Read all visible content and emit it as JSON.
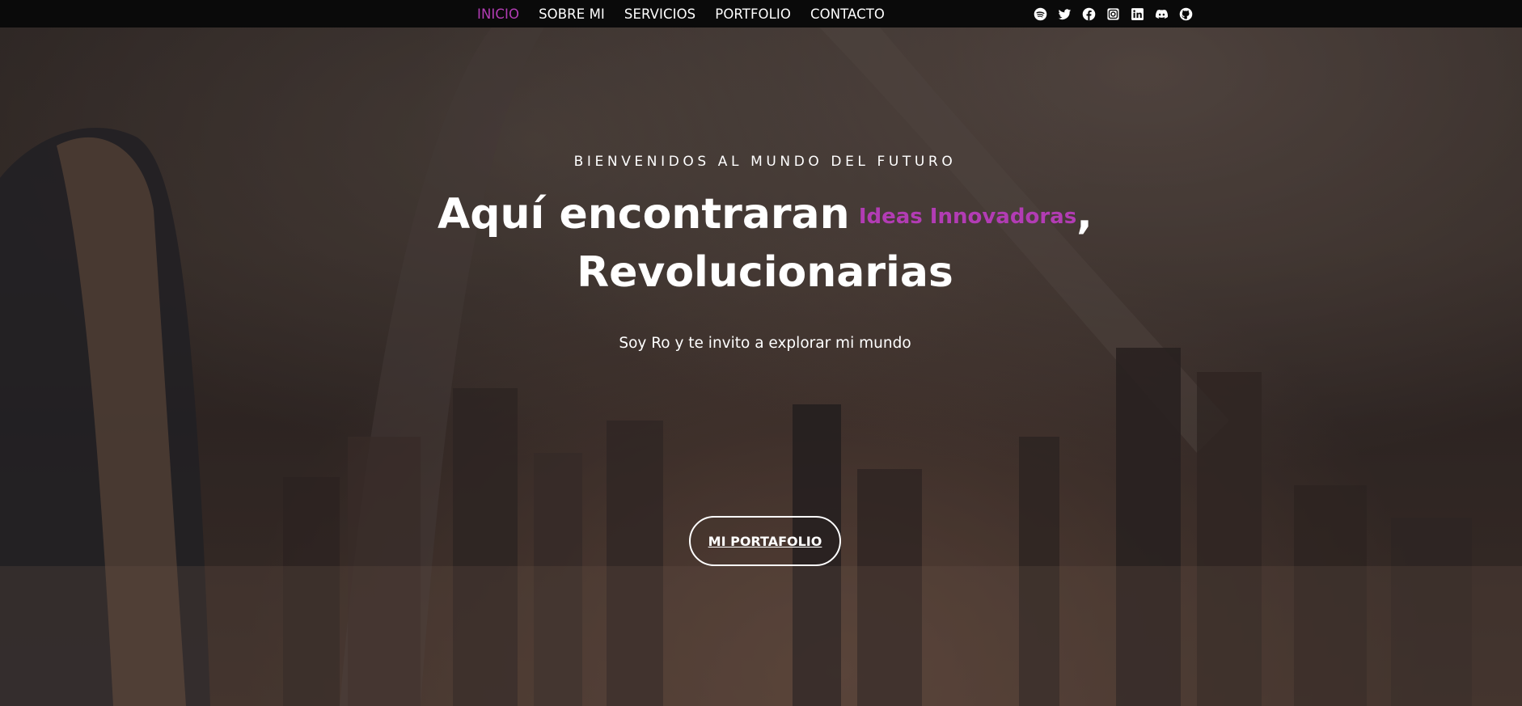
{
  "nav": {
    "items": [
      {
        "label": "INICIO",
        "active": true
      },
      {
        "label": "SOBRE MI",
        "active": false
      },
      {
        "label": "SERVICIOS",
        "active": false
      },
      {
        "label": "PORTFOLIO",
        "active": false
      },
      {
        "label": "CONTACTO",
        "active": false
      }
    ],
    "active_color": "#b23cb4"
  },
  "social": {
    "icons": [
      "spotify-icon",
      "twitter-icon",
      "facebook-icon",
      "instagram-icon",
      "linkedin-icon",
      "discord-icon",
      "github-icon"
    ]
  },
  "hero": {
    "kicker": "BIENVENIDOS AL MUNDO DEL FUTURO",
    "headline_part1": "Aquí encontraran",
    "headline_accent": "Ideas Innovadoras",
    "headline_comma": ",",
    "headline_line2": "Revolucionarias",
    "subtitle": "Soy Ro y te invito a explorar mi mundo",
    "cta_label": "MI PORTAFOLIO"
  },
  "colors": {
    "accent": "#b23cb4",
    "topbar": "#0a0a0a"
  }
}
